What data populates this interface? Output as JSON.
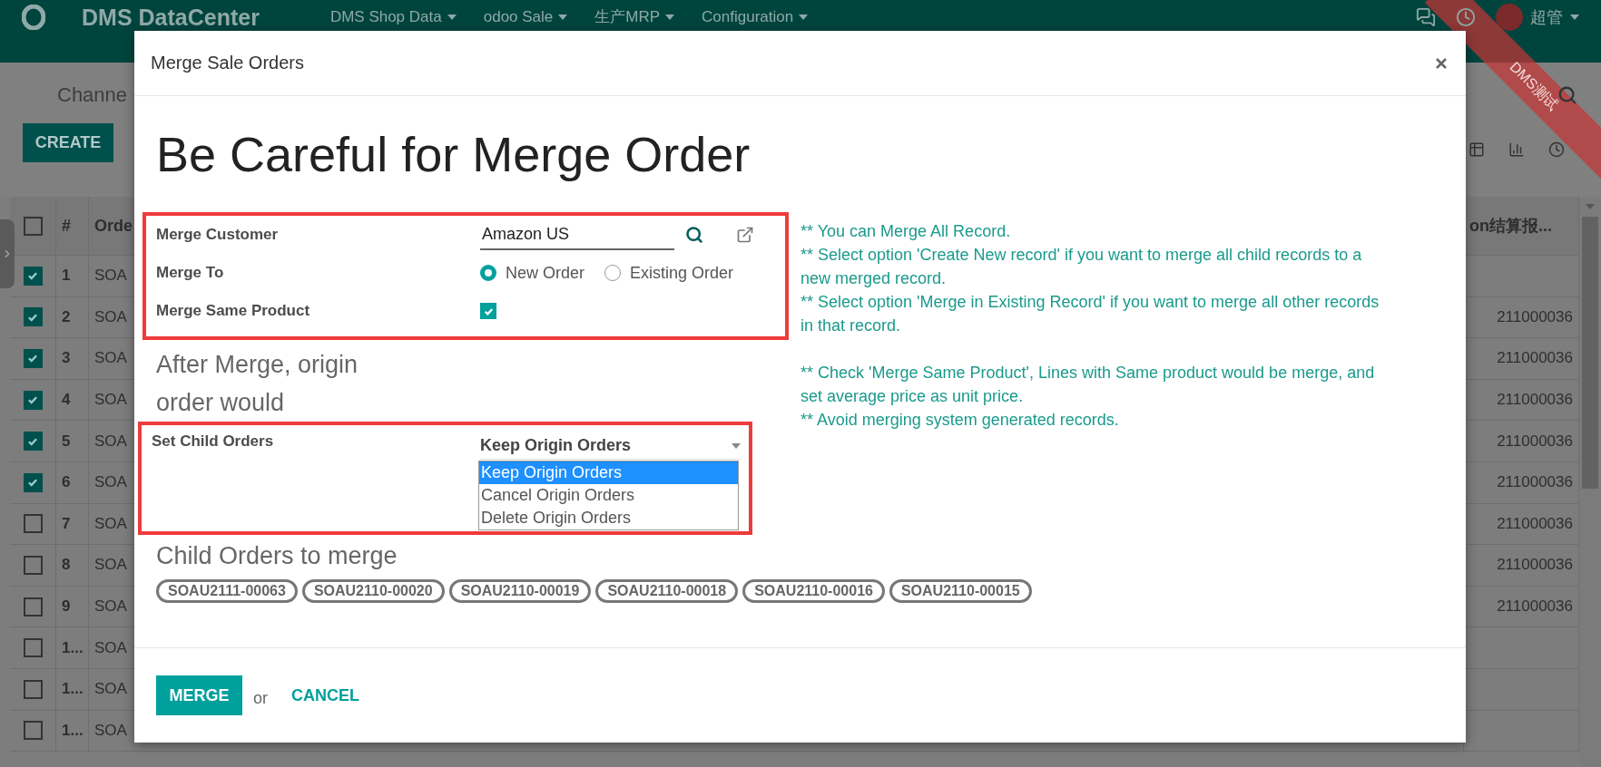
{
  "navbar": {
    "app_name": "DMS DataCenter",
    "menus": [
      {
        "label": "DMS Shop Data"
      },
      {
        "label": "odoo Sale"
      },
      {
        "label": "生产MRP"
      },
      {
        "label": "Configuration"
      }
    ],
    "user": "超管"
  },
  "ribbon": "DMS测试",
  "control_panel": {
    "breadcrumb": "Channe",
    "create_button": "CREATE"
  },
  "table": {
    "header_checked": false,
    "columns": [
      "#",
      "Orde",
      "on结算报..."
    ],
    "rows": [
      {
        "checked": true,
        "number": "1",
        "order": "SOA"
      },
      {
        "checked": true,
        "number": "2",
        "order": "SOA",
        "column_3": "211000036"
      },
      {
        "checked": true,
        "number": "3",
        "order": "SOA",
        "column_3": "211000036"
      },
      {
        "checked": true,
        "number": "4",
        "order": "SOA",
        "column_3": "211000036"
      },
      {
        "checked": true,
        "number": "5",
        "order": "SOA",
        "column_3": "211000036"
      },
      {
        "checked": true,
        "number": "6",
        "order": "SOA",
        "column_3": "211000036"
      },
      {
        "checked": false,
        "number": "7",
        "order": "SOA",
        "column_3": "211000036"
      },
      {
        "checked": false,
        "number": "8",
        "order": "SOA",
        "column_3": "211000036"
      },
      {
        "checked": false,
        "number": "9",
        "order": "SOA",
        "column_3": "211000036"
      },
      {
        "checked": false,
        "number": "1...",
        "order": "SOA"
      },
      {
        "checked": false,
        "number": "1...",
        "order": "SOA"
      },
      {
        "checked": false,
        "number": "1...",
        "order": "SOA"
      }
    ]
  },
  "dialog": {
    "title": "Merge Sale Orders",
    "heading": "Be Careful for Merge Order",
    "fields": [
      {
        "kind": "many2one",
        "label": "Merge Customer",
        "value": "Amazon US"
      },
      {
        "kind": "radio",
        "label": "Merge To",
        "options": [
          {
            "label": "New Order",
            "selected": true
          },
          {
            "label": "Existing Order",
            "selected": false
          }
        ]
      },
      {
        "kind": "checkbox",
        "label": "Merge Same Product",
        "checked": true
      }
    ],
    "help": [
      [
        "** You can Merge All Record.",
        "** Select option 'Create New record' if you want to merge all child records to a new merged record.",
        "** Select option 'Merge in Existing Record' if you want to merge all other records in that record."
      ],
      [
        "** Check 'Merge Same Product', Lines with Same product would be merge, and set average price as unit price.",
        "** Avoid merging system generated records."
      ]
    ],
    "after_merge_heading": "After Merge, origin order would",
    "child_select": {
      "label": "Set Child Orders",
      "value": "Keep Origin Orders",
      "expanded": true,
      "options": [
        {
          "label": "Keep Origin Orders",
          "selected": true
        },
        {
          "label": "Cancel Origin Orders",
          "selected": false
        },
        {
          "label": "Delete Origin Orders",
          "selected": false
        }
      ]
    },
    "child_orders_heading": "Child Orders to merge",
    "child_orders": [
      "SOAU2111-00063",
      "SOAU2110-00020",
      "SOAU2110-00019",
      "SOAU2110-00018",
      "SOAU2110-00016",
      "SOAU2110-00015"
    ],
    "merge_button": "MERGE",
    "or": "or",
    "cancel_button": "CANCEL"
  }
}
